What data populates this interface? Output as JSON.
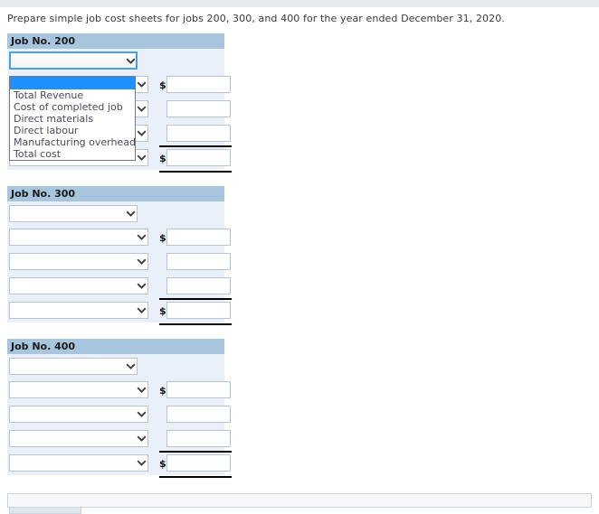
{
  "instruction": "Prepare simple job cost sheets for jobs 200, 300, and 400 for the year ended December 31, 2020.",
  "currency_symbol": "$",
  "dropdown_options": [
    "",
    "Total Revenue",
    "Cost of completed job",
    "Direct materials",
    "Direct labour",
    "Manufacturing overhead",
    "Total cost"
  ],
  "open_dropdown": {
    "owner": "job-200-row-1-select",
    "selected_index": 0,
    "items": [
      "",
      "Total Revenue",
      "Cost of completed job",
      "Direct materials",
      "Direct labour",
      "Manufacturing overhead",
      "Total cost"
    ]
  },
  "jobs": [
    {
      "title": "Job No. 200",
      "rows": [
        {
          "select_value": "",
          "has_amount": false,
          "has_dollar": false,
          "amount_value": "",
          "underlined": false
        },
        {
          "select_value": "",
          "has_amount": true,
          "has_dollar": true,
          "amount_value": "",
          "underlined": false
        },
        {
          "select_value": "",
          "has_amount": true,
          "has_dollar": false,
          "amount_value": "",
          "underlined": false
        },
        {
          "select_value": "",
          "has_amount": true,
          "has_dollar": false,
          "amount_value": "",
          "underlined": false
        },
        {
          "select_value": "",
          "has_amount": true,
          "has_dollar": true,
          "amount_value": "",
          "underlined": true
        }
      ]
    },
    {
      "title": "Job No. 300",
      "rows": [
        {
          "select_value": "",
          "has_amount": false,
          "has_dollar": false,
          "amount_value": "",
          "underlined": false
        },
        {
          "select_value": "",
          "has_amount": true,
          "has_dollar": true,
          "amount_value": "",
          "underlined": false
        },
        {
          "select_value": "",
          "has_amount": true,
          "has_dollar": false,
          "amount_value": "",
          "underlined": false
        },
        {
          "select_value": "",
          "has_amount": true,
          "has_dollar": false,
          "amount_value": "",
          "underlined": false
        },
        {
          "select_value": "",
          "has_amount": true,
          "has_dollar": true,
          "amount_value": "",
          "underlined": true
        }
      ]
    },
    {
      "title": "Job No. 400",
      "rows": [
        {
          "select_value": "",
          "has_amount": false,
          "has_dollar": false,
          "amount_value": "",
          "underlined": false
        },
        {
          "select_value": "",
          "has_amount": true,
          "has_dollar": true,
          "amount_value": "",
          "underlined": false
        },
        {
          "select_value": "",
          "has_amount": true,
          "has_dollar": false,
          "amount_value": "",
          "underlined": false
        },
        {
          "select_value": "",
          "has_amount": true,
          "has_dollar": false,
          "amount_value": "",
          "underlined": false
        },
        {
          "select_value": "",
          "has_amount": true,
          "has_dollar": true,
          "amount_value": "",
          "underlined": true
        }
      ]
    }
  ],
  "colors": {
    "header_bar": "#a7c5dd",
    "row_bg": "#e9f0f9",
    "focus_border": "#4a9fe0",
    "option_highlight": "#1e90ff",
    "top_strip": "#e5eaef"
  }
}
